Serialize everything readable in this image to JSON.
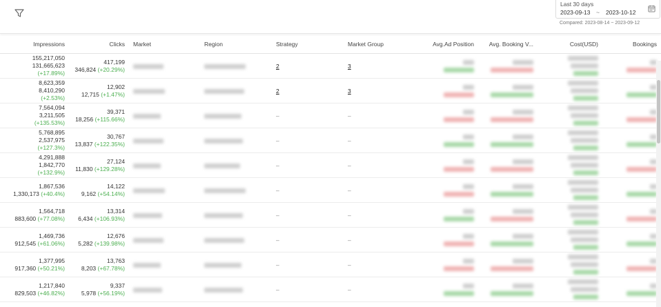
{
  "date_range": {
    "preset": "Last 30 days",
    "start": "2023-09-13",
    "separator": "~",
    "end": "2023-10-12",
    "compared": "Compared: 2023-08-14 ~ 2023-09-12"
  },
  "columns": [
    "Impressions",
    "Clicks",
    "Market",
    "Region",
    "Strategy",
    "Market Group",
    "Avg.Ad Position",
    "Avg. Booking V...",
    "Cost(USD)",
    "Bookings"
  ],
  "rows": [
    {
      "imp": "155,217,050",
      "imp_prev": "131,665,623",
      "imp_delta": "(+17.89%)",
      "clk": "417,199",
      "clk_prev": "346,824",
      "clk_delta": "(+20.29%)",
      "strategy": "2",
      "market_group": "3"
    },
    {
      "imp": "8,623,359",
      "imp_prev": "8,410,290",
      "imp_delta": "(+2.53%)",
      "clk": "12,902",
      "clk_prev": "12,715",
      "clk_delta": "(+1.47%)",
      "strategy": "2",
      "market_group": "3"
    },
    {
      "imp": "7,564,094",
      "imp_prev": "3,211,505",
      "imp_delta": "(+135.53%)",
      "clk": "39,371",
      "clk_prev": "18,256",
      "clk_delta": "(+115.66%)",
      "strategy": "–",
      "market_group": "–"
    },
    {
      "imp": "5,768,895",
      "imp_prev": "2,537,975",
      "imp_delta": "(+127.3%)",
      "clk": "30,767",
      "clk_prev": "13,837",
      "clk_delta": "(+122.35%)",
      "strategy": "–",
      "market_group": "–"
    },
    {
      "imp": "4,291,888",
      "imp_prev": "1,842,770",
      "imp_delta": "(+132.9%)",
      "clk": "27,124",
      "clk_prev": "11,830",
      "clk_delta": "(+129.28%)",
      "strategy": "–",
      "market_group": "–"
    },
    {
      "imp": "1,867,536",
      "imp_prev": "1,330,173",
      "imp_delta": "(+40.4%)",
      "clk": "14,122",
      "clk_prev": "9,162",
      "clk_delta": "(+54.14%)",
      "strategy": "–",
      "market_group": "–"
    },
    {
      "imp": "1,564,718",
      "imp_prev": "883,600",
      "imp_delta": "(+77.08%)",
      "clk": "13,314",
      "clk_prev": "6,434",
      "clk_delta": "(+106.93%)",
      "strategy": "–",
      "market_group": "–"
    },
    {
      "imp": "1,469,736",
      "imp_prev": "912,545",
      "imp_delta": "(+61.06%)",
      "clk": "12,676",
      "clk_prev": "5,282",
      "clk_delta": "(+139.98%)",
      "strategy": "–",
      "market_group": "–"
    },
    {
      "imp": "1,377,995",
      "imp_prev": "917,360",
      "imp_delta": "(+50.21%)",
      "clk": "13,763",
      "clk_prev": "8,203",
      "clk_delta": "(+67.78%)",
      "strategy": "–",
      "market_group": "–"
    },
    {
      "imp": "1,217,840",
      "imp_prev": "829,503",
      "imp_delta": "(+46.82%)",
      "clk": "9,337",
      "clk_prev": "5,978",
      "clk_delta": "(+56.19%)",
      "strategy": "–",
      "market_group": "–"
    }
  ],
  "colors": {
    "positive": "#4caf50",
    "negative": "#e57373",
    "blur": "#cfcfcf"
  },
  "icons": {
    "filter": "filter-icon",
    "calendar": "calendar-icon"
  }
}
